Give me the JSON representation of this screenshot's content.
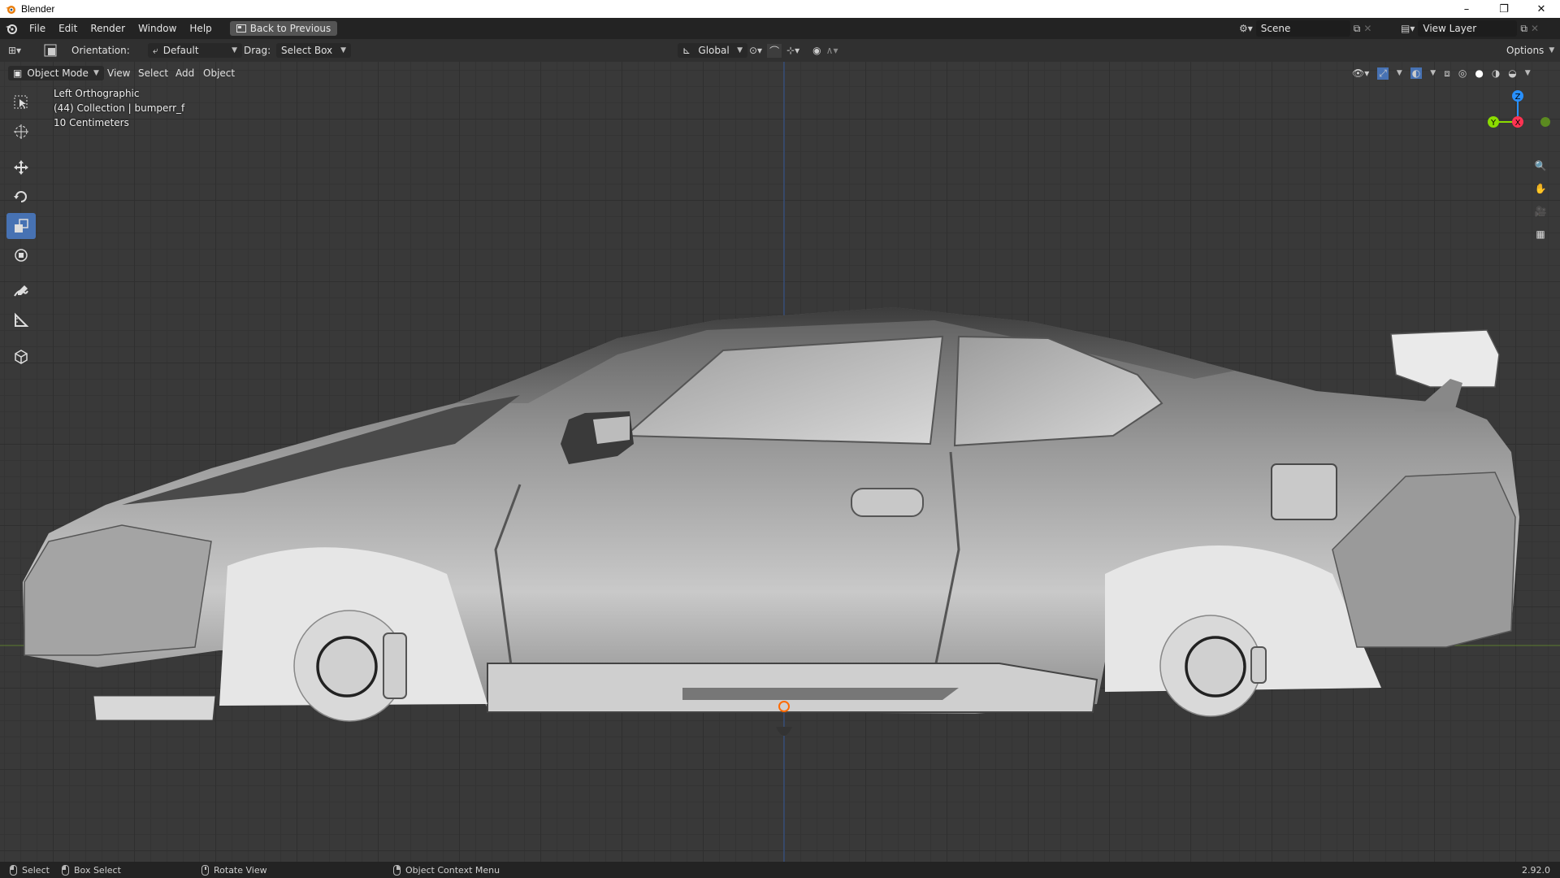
{
  "window": {
    "title": "Blender",
    "min": "–",
    "max": "❐",
    "close": "✕"
  },
  "menubar": {
    "items": [
      "File",
      "Edit",
      "Render",
      "Window",
      "Help"
    ],
    "back_button": "Back to Previous",
    "scene_label": "Scene",
    "view_layer_label": "View Layer"
  },
  "toolheader": {
    "orientation_label": "Orientation:",
    "orientation_value": "Default",
    "drag_label": "Drag:",
    "drag_value": "Select Box",
    "transform_orientation": "Global",
    "options_label": "Options"
  },
  "viewheader": {
    "mode": "Object Mode",
    "menus": [
      "View",
      "Select",
      "Add",
      "Object"
    ]
  },
  "viewport": {
    "view_name": "Left Orthographic",
    "collection_info": "(44) Collection | bumperr_f",
    "grid_scale": "10 Centimeters",
    "gizmo": {
      "z": "Z",
      "y": "Y",
      "x": "X"
    },
    "colors": {
      "x_axis": "#ff3352",
      "y_axis": "#8bdc00",
      "z_axis": "#2890ff",
      "floor_line": "#5a7a2e",
      "vertical_line": "#3a5d9c"
    }
  },
  "toolbar": {
    "tools": [
      "select-box-icon",
      "cursor-icon",
      "move-icon",
      "rotate-icon",
      "scale-icon",
      "transform-icon",
      "annotate-icon",
      "measure-icon",
      "add-cube-icon"
    ],
    "active_tool": "scale-icon"
  },
  "statusbar": {
    "select": "Select",
    "box_select": "Box Select",
    "rotate_view": "Rotate View",
    "context_menu": "Object Context Menu",
    "version": "2.92.0"
  }
}
